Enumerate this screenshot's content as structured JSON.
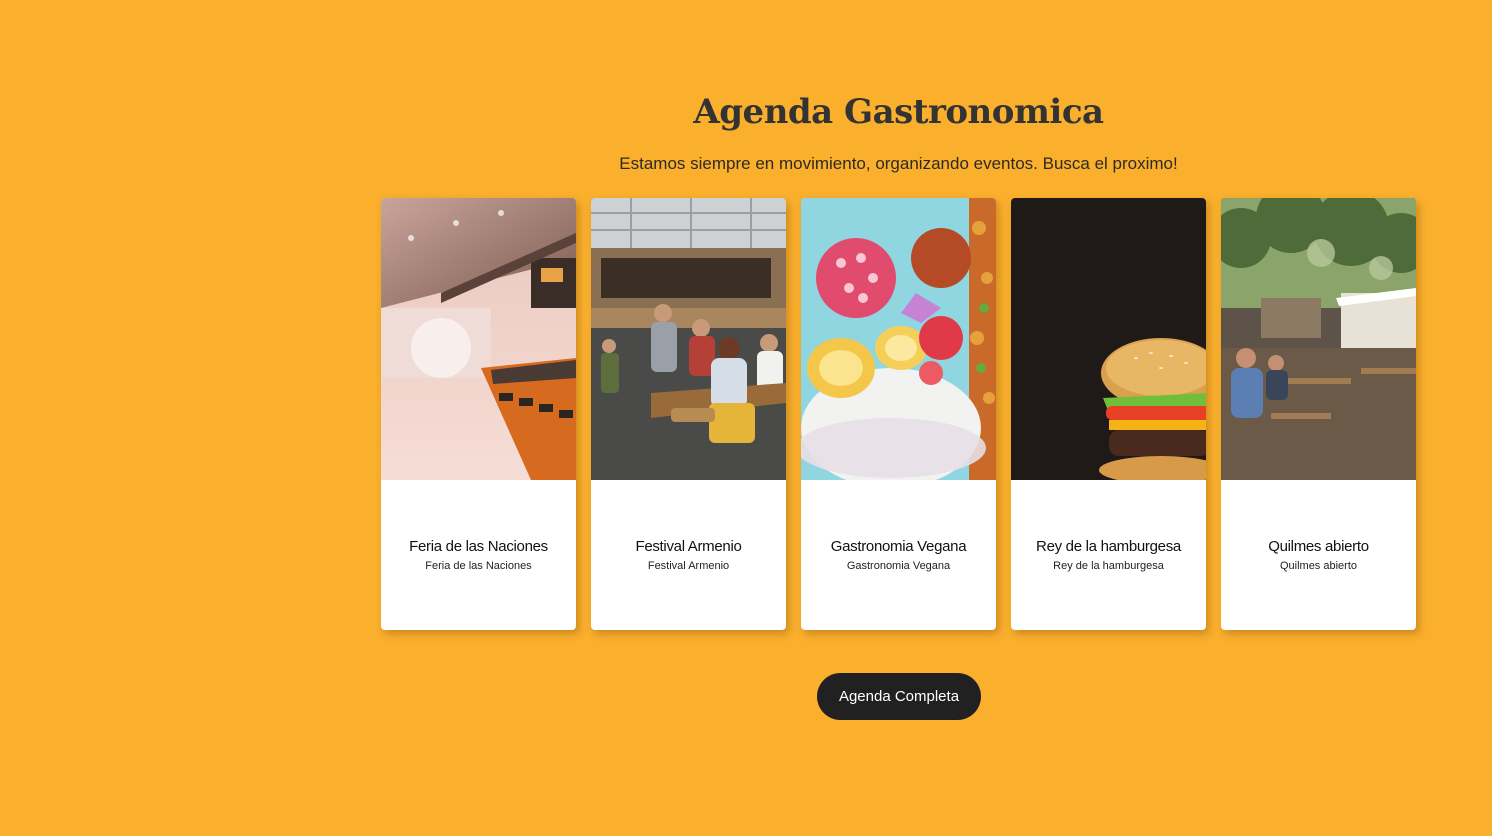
{
  "section": {
    "title": "Agenda Gastronomica",
    "subtitle": "Estamos siempre en movimiento, organizando eventos. Busca el proximo!",
    "cta_label": "Agenda Completa"
  },
  "events": [
    {
      "title": "Feria de las Naciones",
      "subtitle": "Feria de las Naciones",
      "image": "food-court-photo"
    },
    {
      "title": "Festival Armenio",
      "subtitle": "Festival Armenio",
      "image": "food-truck-crowd-photo"
    },
    {
      "title": "Gastronomia Vegana",
      "subtitle": "Gastronomia Vegana",
      "image": "fruit-bowl-photo"
    },
    {
      "title": "Rey de la hamburgesa",
      "subtitle": "Rey de la hamburgesa",
      "image": "burger-photo"
    },
    {
      "title": "Quilmes abierto",
      "subtitle": "Quilmes abierto",
      "image": "outdoor-beer-garden-photo"
    }
  ],
  "colors": {
    "background": "#FAAF2D",
    "title": "#333333",
    "button": "#212121",
    "card": "#FFFFFF"
  }
}
